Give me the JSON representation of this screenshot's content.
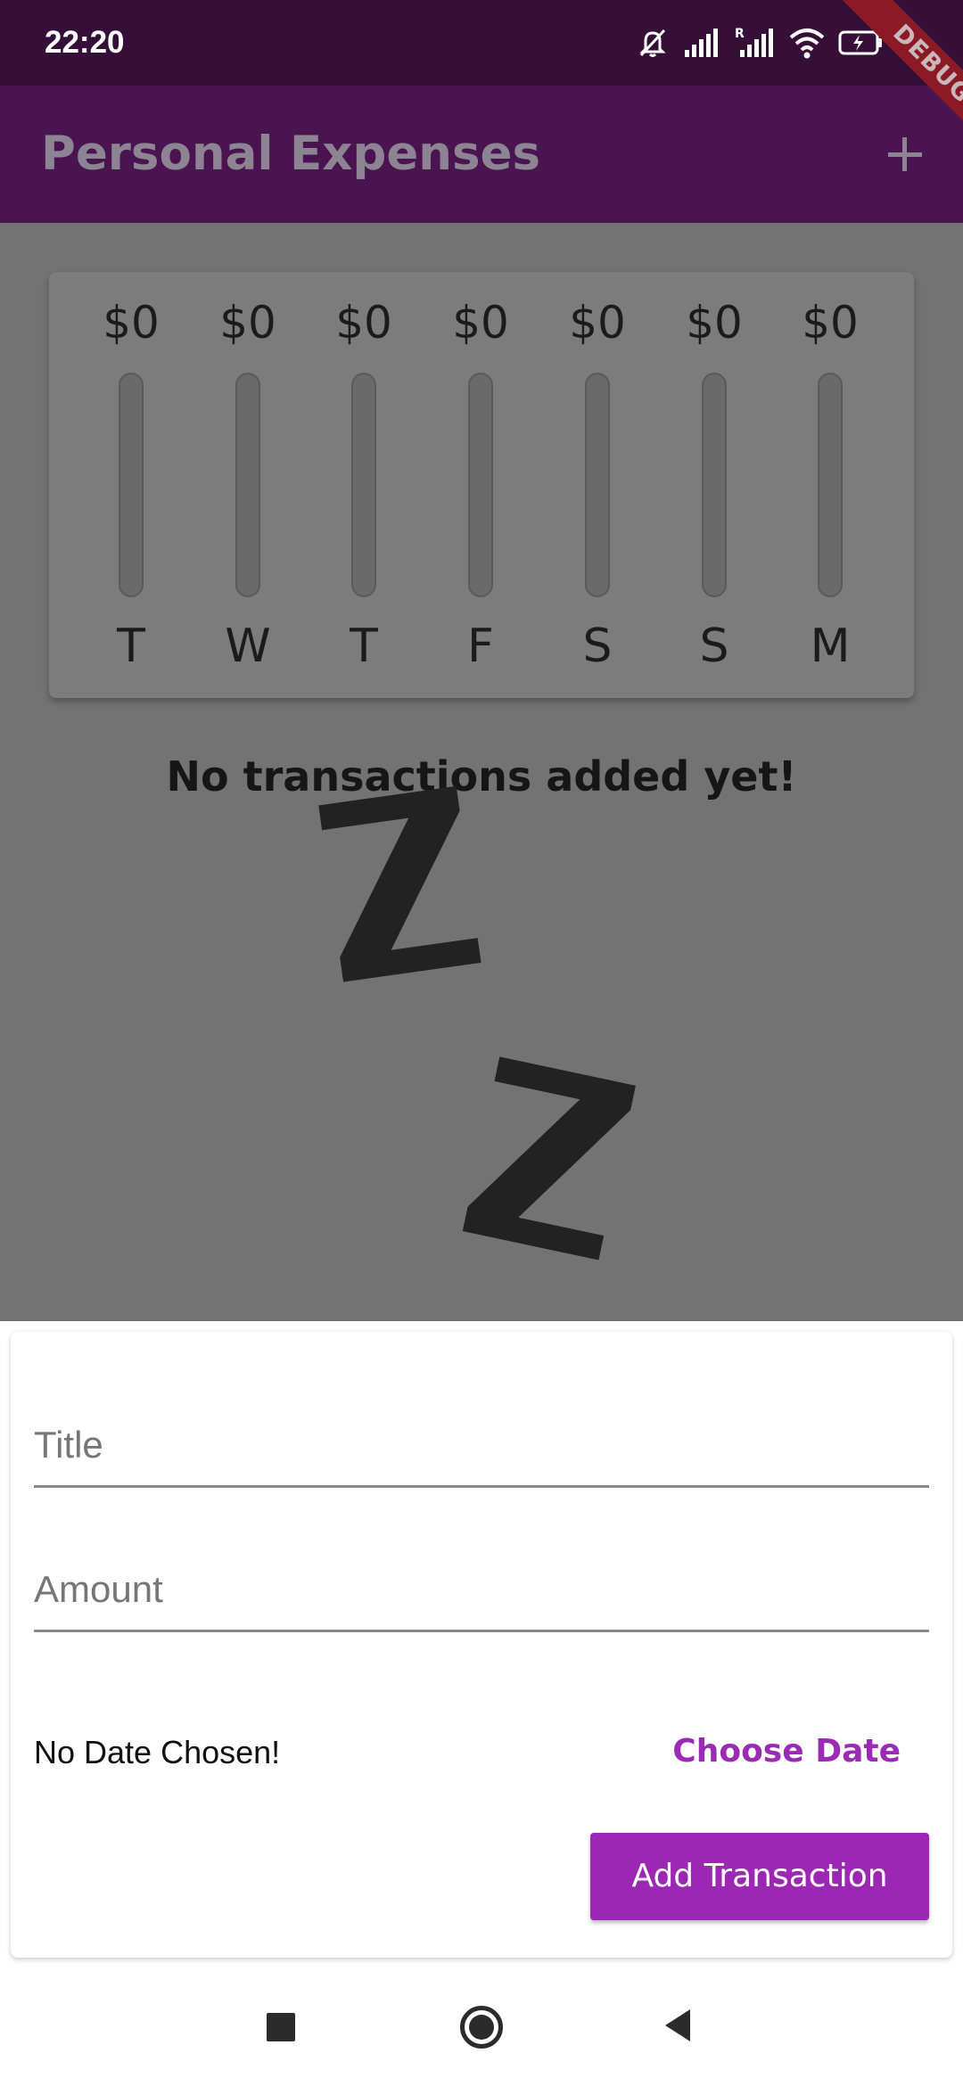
{
  "status_bar": {
    "time": "22:20",
    "icons": [
      "mute-icon",
      "signal-icon",
      "signal-roaming-icon",
      "wifi-icon",
      "battery-icon"
    ]
  },
  "app_bar": {
    "title": "Personal Expenses",
    "action_icon": "add-icon"
  },
  "debug_banner": "DEBUG",
  "chart": {
    "days": [
      {
        "label": "T",
        "amount": "$0",
        "fill": 0
      },
      {
        "label": "W",
        "amount": "$0",
        "fill": 0
      },
      {
        "label": "T",
        "amount": "$0",
        "fill": 0
      },
      {
        "label": "F",
        "amount": "$0",
        "fill": 0
      },
      {
        "label": "S",
        "amount": "$0",
        "fill": 0
      },
      {
        "label": "S",
        "amount": "$0",
        "fill": 0
      },
      {
        "label": "M",
        "amount": "$0",
        "fill": 0
      }
    ]
  },
  "empty_state": {
    "message": "No transactions added yet!",
    "icon": "sleeping-zz-image"
  },
  "form": {
    "title_placeholder": "Title",
    "amount_placeholder": "Amount",
    "date_text": "No Date Chosen!",
    "choose_date_label": "Choose Date",
    "submit_label": "Add Transaction"
  },
  "nav_bar": {
    "icons": [
      "recents-icon",
      "home-icon",
      "back-icon"
    ]
  },
  "colors": {
    "status_bar": "#360f38",
    "app_bar": "#4a1450",
    "accent": "#9b27b3",
    "scrim": "#737373"
  }
}
